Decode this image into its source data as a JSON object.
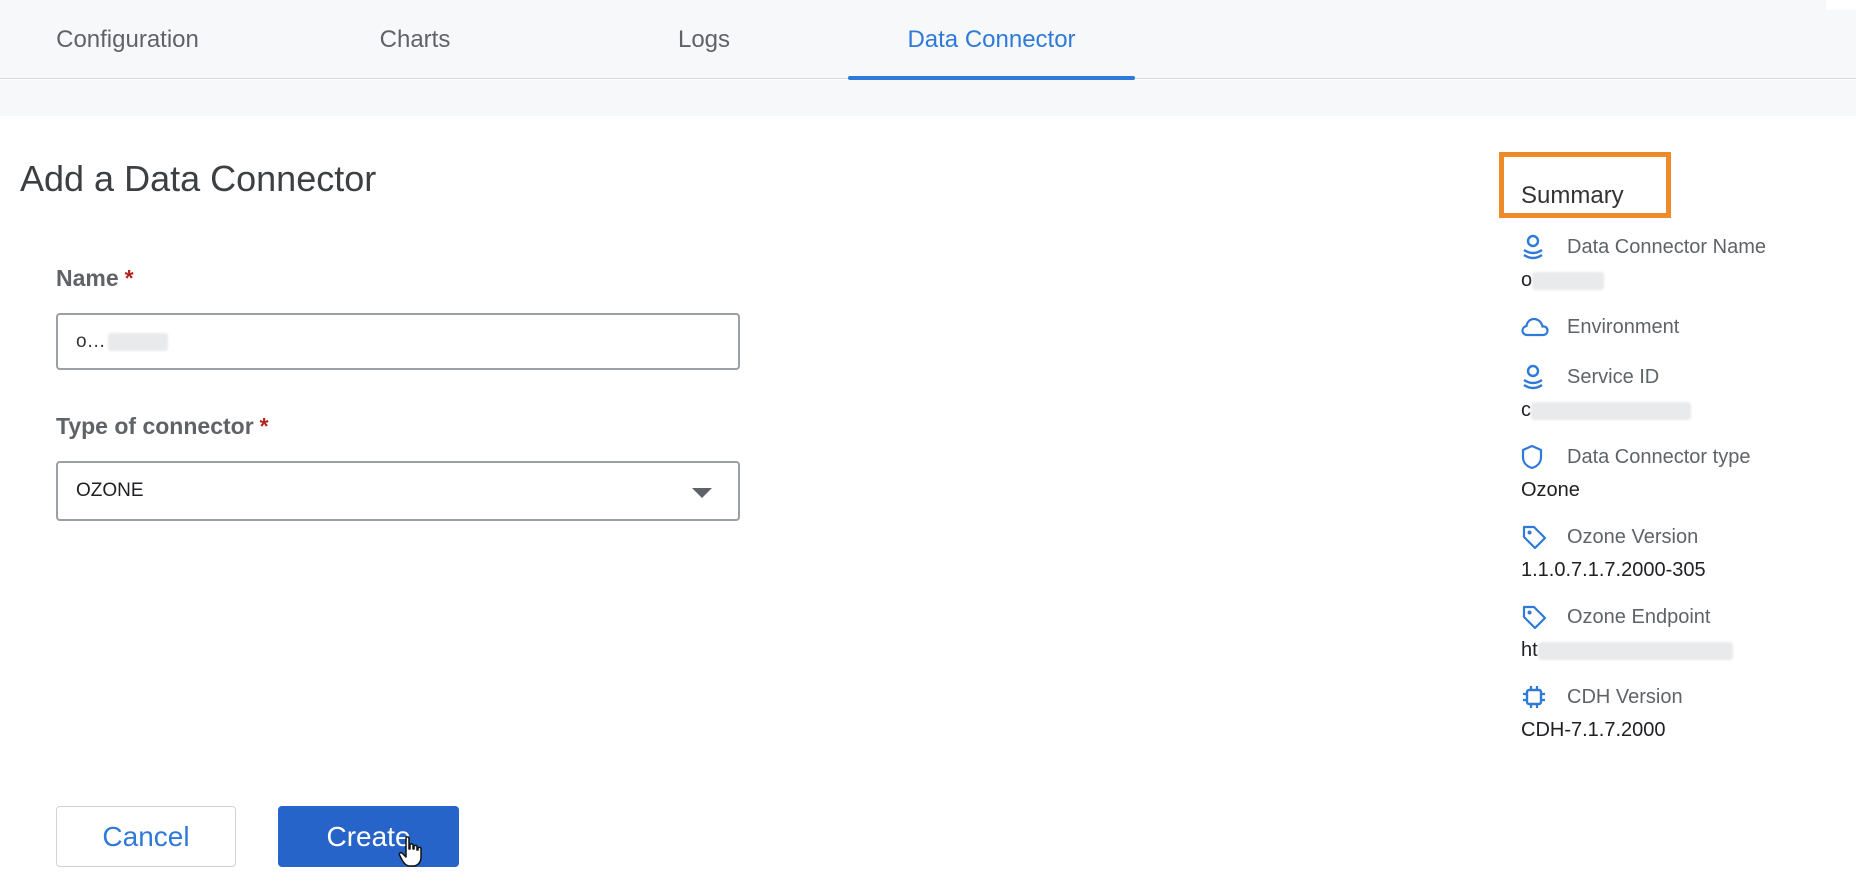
{
  "tabs": [
    {
      "label": "Configuration",
      "active": false
    },
    {
      "label": "Charts",
      "active": false
    },
    {
      "label": "Logs",
      "active": false
    },
    {
      "label": "Data Connector",
      "active": true
    }
  ],
  "page": {
    "title": "Add a Data Connector"
  },
  "form": {
    "name_label": "Name",
    "name_value": "o…",
    "required_marker": "*",
    "type_label": "Type of connector",
    "type_value": "OZONE"
  },
  "buttons": {
    "cancel": "Cancel",
    "create": "Create"
  },
  "summary": {
    "title": "Summary",
    "items": [
      {
        "label": "Data Connector Name",
        "value": "o",
        "icon": "user-stack-icon"
      },
      {
        "label": "Environment",
        "value": "",
        "icon": "cloud-icon"
      },
      {
        "label": "Service ID",
        "value": "c",
        "icon": "user-stack-icon"
      },
      {
        "label": "Data Connector type",
        "value": "Ozone",
        "icon": "shield-icon"
      },
      {
        "label": "Ozone Version",
        "value": "1.1.0.7.1.7.2000-305",
        "icon": "tag-icon"
      },
      {
        "label": "Ozone Endpoint",
        "value": "ht",
        "icon": "tag-icon"
      },
      {
        "label": "CDH Version",
        "value": "CDH-7.1.7.2000",
        "icon": "chip-icon"
      }
    ]
  },
  "colors": {
    "accent": "#2f7ad8",
    "primary_button": "#2664c9",
    "highlight_box": "#ef8a2a",
    "required": "#b3261e"
  }
}
